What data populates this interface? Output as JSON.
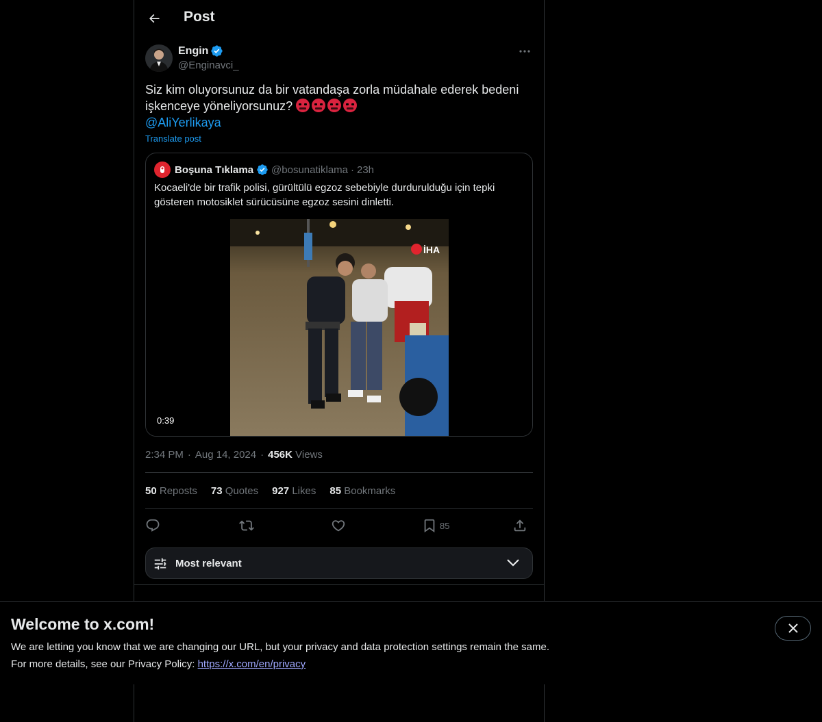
{
  "header": {
    "title": "Post"
  },
  "post": {
    "author": {
      "name": "Engin",
      "handle": "@Enginavci_",
      "verified": true
    },
    "text_line1": "Siz kim oluyorsunuz da bir vatandaşa zorla müdahale ederek bedeni",
    "text_line2": "işkenceye yöneliyorsunuz?",
    "emojis": [
      "angry-face-icon",
      "angry-face-icon",
      "angry-face-icon",
      "angry-face-icon"
    ],
    "mention": "@AliYerlikaya",
    "translate_label": "Translate post",
    "time": "2:34 PM",
    "date": "Aug 14, 2024",
    "views_count": "456K",
    "views_label": "Views",
    "sep": "·"
  },
  "quote": {
    "name": "Boşuna Tıklama",
    "handle": "@bosunatiklama",
    "sep": "·",
    "time": "23h",
    "text": "Kocaeli'de bir trafik polisi, gürültülü egzoz sebebiyle durdurulduğu için tepki gösteren motosiklet sürücüsüne egzoz sesini dinletti.",
    "video": {
      "duration": "0:39",
      "watermark": "İHA"
    }
  },
  "stats": [
    {
      "count": "50",
      "label": "Reposts"
    },
    {
      "count": "73",
      "label": "Quotes"
    },
    {
      "count": "927",
      "label": "Likes"
    },
    {
      "count": "85",
      "label": "Bookmarks"
    }
  ],
  "actions": {
    "reply": "reply-icon",
    "repost": "repost-icon",
    "like": "heart-icon",
    "bookmark_count": "85",
    "share": "share-icon"
  },
  "sort": {
    "label": "Most relevant"
  },
  "banner": {
    "title": "Welcome to x.com!",
    "line1": "We are letting you know that we are changing our URL, but your privacy and data protection settings remain the same.",
    "line2_prefix": "For more details, see our Privacy Policy: ",
    "link": "https://x.com/en/privacy"
  },
  "colors": {
    "accent": "#1d9bf0",
    "background": "#000000",
    "border": "#2f3336",
    "muted": "#71767b"
  }
}
